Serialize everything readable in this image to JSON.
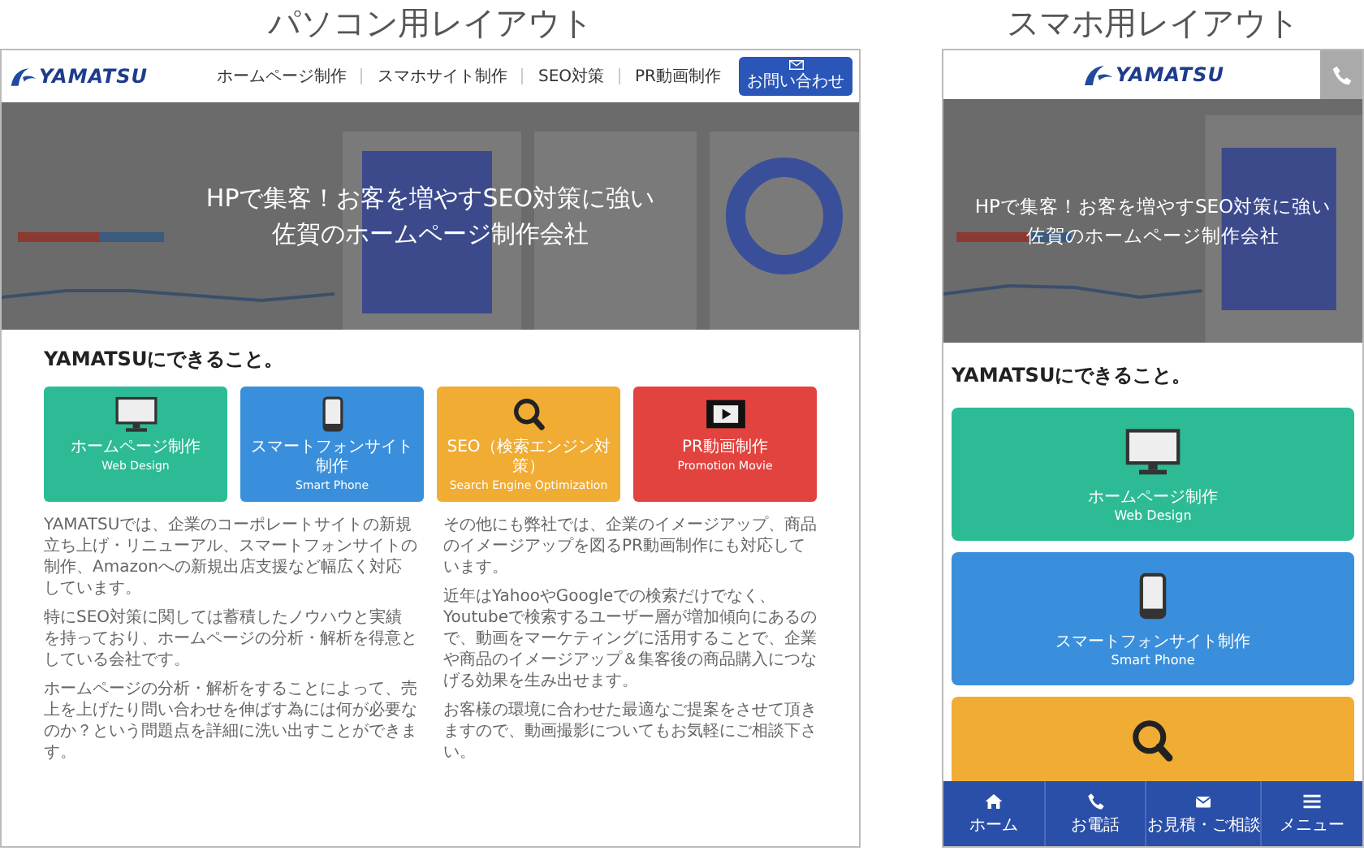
{
  "captions": [
    "パソコン用レイアウト",
    "スマホ用レイアウト"
  ],
  "pc": {
    "logo": "YAMATSU",
    "nav": [
      {
        "label": "ホームページ制作"
      },
      {
        "label": "スマホサイト制作"
      },
      {
        "label": "SEO対策"
      },
      {
        "label": "PR動画制作"
      }
    ],
    "contact": {
      "label": "お問い合わせ"
    },
    "hero": {
      "lines": [
        "HPで集客！お客を増やすSEO対策に強い",
        "佐賀のホームページ制作会社"
      ]
    },
    "heading": "YAMATSUにできること。",
    "services": [
      {
        "kind": "monitor",
        "color": "#2dbb95",
        "title": "ホームページ制作",
        "subtitle": "Web Design"
      },
      {
        "kind": "phone",
        "color": "#3a8fdc",
        "title": "スマートフォンサイト制作",
        "subtitle": "Smart Phone"
      },
      {
        "kind": "search",
        "color": "#f0ac33",
        "title": "SEO（検索エンジン対策）",
        "subtitle": "Search Engine Optimization"
      },
      {
        "kind": "film",
        "color": "#e2433f",
        "title": "PR動画制作",
        "subtitle": "Promotion Movie"
      }
    ],
    "columns": [
      [
        "YAMATSUでは、企業のコーポレートサイトの新規立ち上げ・リニューアル、スマートフォンサイトの制作、Amazonへの新規出店支援など幅広く対応しています。",
        "特にSEO対策に関しては蓄積したノウハウと実績を持っており、ホームページの分析・解析を得意としている会社です。",
        "ホームページの分析・解析をすることによって、売上を上げたり問い合わせを伸ばす為には何が必要なのか？という問題点を詳細に洗い出すことができます。"
      ],
      [
        "その他にも弊社では、企業のイメージアップ、商品のイメージアップを図るPR動画制作にも対応しています。",
        "近年はYahooやGoogleでの検索だけでなく、Youtubeで検索するユーザー層が増加傾向にあるので、動画をマーケティングに活用することで、企業や商品のイメージアップ＆集客後の商品購入につなげる効果を生み出せます。",
        "お客様の環境に合わせた最適なご提案をさせて頂きますので、動画撮影についてもお気軽にご相談下さい。"
      ]
    ]
  },
  "mobile": {
    "logo": "YAMATSU",
    "hero": {
      "lines": [
        "HPで集客！お客を増やすSEO対策に強い",
        "佐賀のホームページ制作会社"
      ]
    },
    "heading": "YAMATSUにできること。",
    "services": [
      {
        "kind": "monitor",
        "color": "#2dbb95",
        "title": "ホームページ制作",
        "subtitle": "Web Design"
      },
      {
        "kind": "phone",
        "color": "#3a8fdc",
        "title": "スマートフォンサイト制作",
        "subtitle": "Smart Phone"
      },
      {
        "kind": "search",
        "color": "#f0ac33"
      }
    ],
    "bottom_nav": [
      {
        "kind": "home",
        "label": "ホーム"
      },
      {
        "kind": "phone",
        "label": "お電話"
      },
      {
        "kind": "mail",
        "label": "お見積・ご相談"
      },
      {
        "kind": "menu",
        "label": "メニュー"
      }
    ]
  }
}
